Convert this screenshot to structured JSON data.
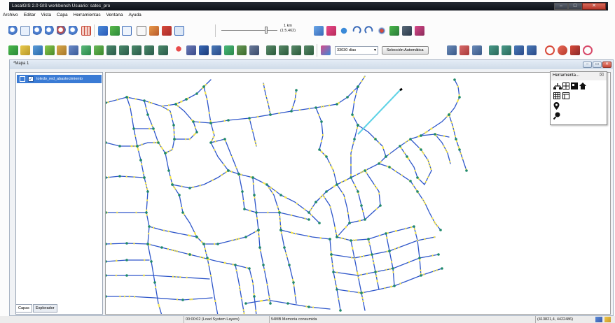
{
  "window": {
    "title": "LocalGIS 2.0 GIS workbench Usuario: satec_pro",
    "minimize": "–",
    "maximize": "□",
    "close": "✕"
  },
  "menu": [
    "Archivo",
    "Editar",
    "Vista",
    "Capa",
    "Herramientas",
    "Ventana",
    "Ayuda"
  ],
  "toolbar": {
    "scale_value": "1 km",
    "scale_ratio": "(1:5.462)",
    "days_combo": "33030 días",
    "selection_button": "Selección Automática"
  },
  "map_window": {
    "title": "*Mapa 1"
  },
  "layers": [
    {
      "name": "toledo_red_abastecimiento",
      "checked": true,
      "selected": true
    }
  ],
  "panel_tabs": [
    "Capas",
    "Explorador"
  ],
  "tools_palette": {
    "title": "Herramienta...",
    "close": "☒"
  },
  "status": {
    "time": "00:00:02 (Load System Layers)",
    "memory": "54MB Memoria consumida",
    "coordinates": "(413821,4, 4422486)"
  },
  "colors": {
    "network_line": "#2d55c9",
    "highlight_line": "#5fd3e6",
    "valve": "#f5e54a",
    "node": "#1f8a6a",
    "selection": "#3a7bd5"
  }
}
